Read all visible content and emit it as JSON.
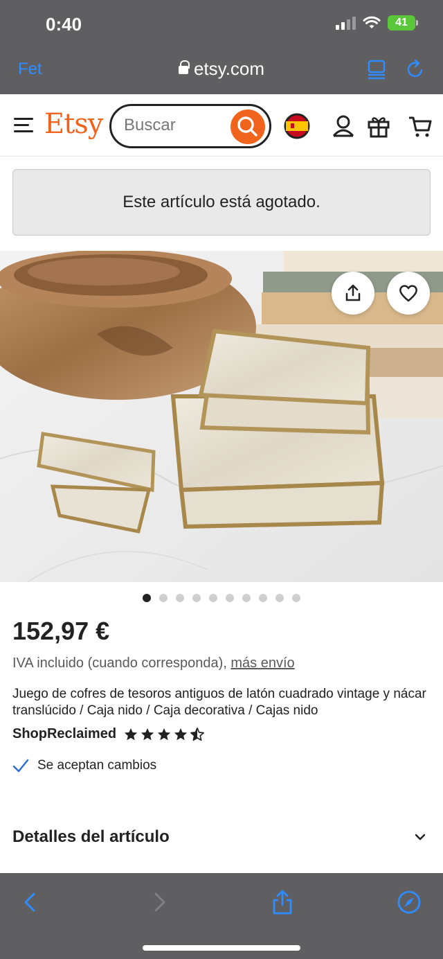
{
  "status_bar": {
    "time": "0:40",
    "battery": "41"
  },
  "safari": {
    "done_label": "Fet",
    "url": "etsy.com"
  },
  "header": {
    "logo": "Etsy",
    "search_placeholder": "Buscar",
    "locale_flag": "spain-flag"
  },
  "notice": {
    "sold_out": "Este artículo está agotado."
  },
  "carousel": {
    "total": 10,
    "active": 0
  },
  "product": {
    "price": "152,97 €",
    "vat_text": "IVA incluido (cuando corresponda),",
    "shipping_link": "más envío",
    "title": "Juego de cofres de tesoros antiguos de latón cuadrado vintage y nácar translúcido / Caja nido / Caja decorativa / Cajas nido",
    "shop_name": "ShopReclaimed",
    "rating": 4.5,
    "exchange_text": "Se aceptan cambios"
  },
  "details": {
    "title": "Detalles del artículo"
  },
  "colors": {
    "etsy_orange": "#f1641e",
    "ios_blue": "#2e8cff",
    "safari_bar": "#5f5f62"
  }
}
